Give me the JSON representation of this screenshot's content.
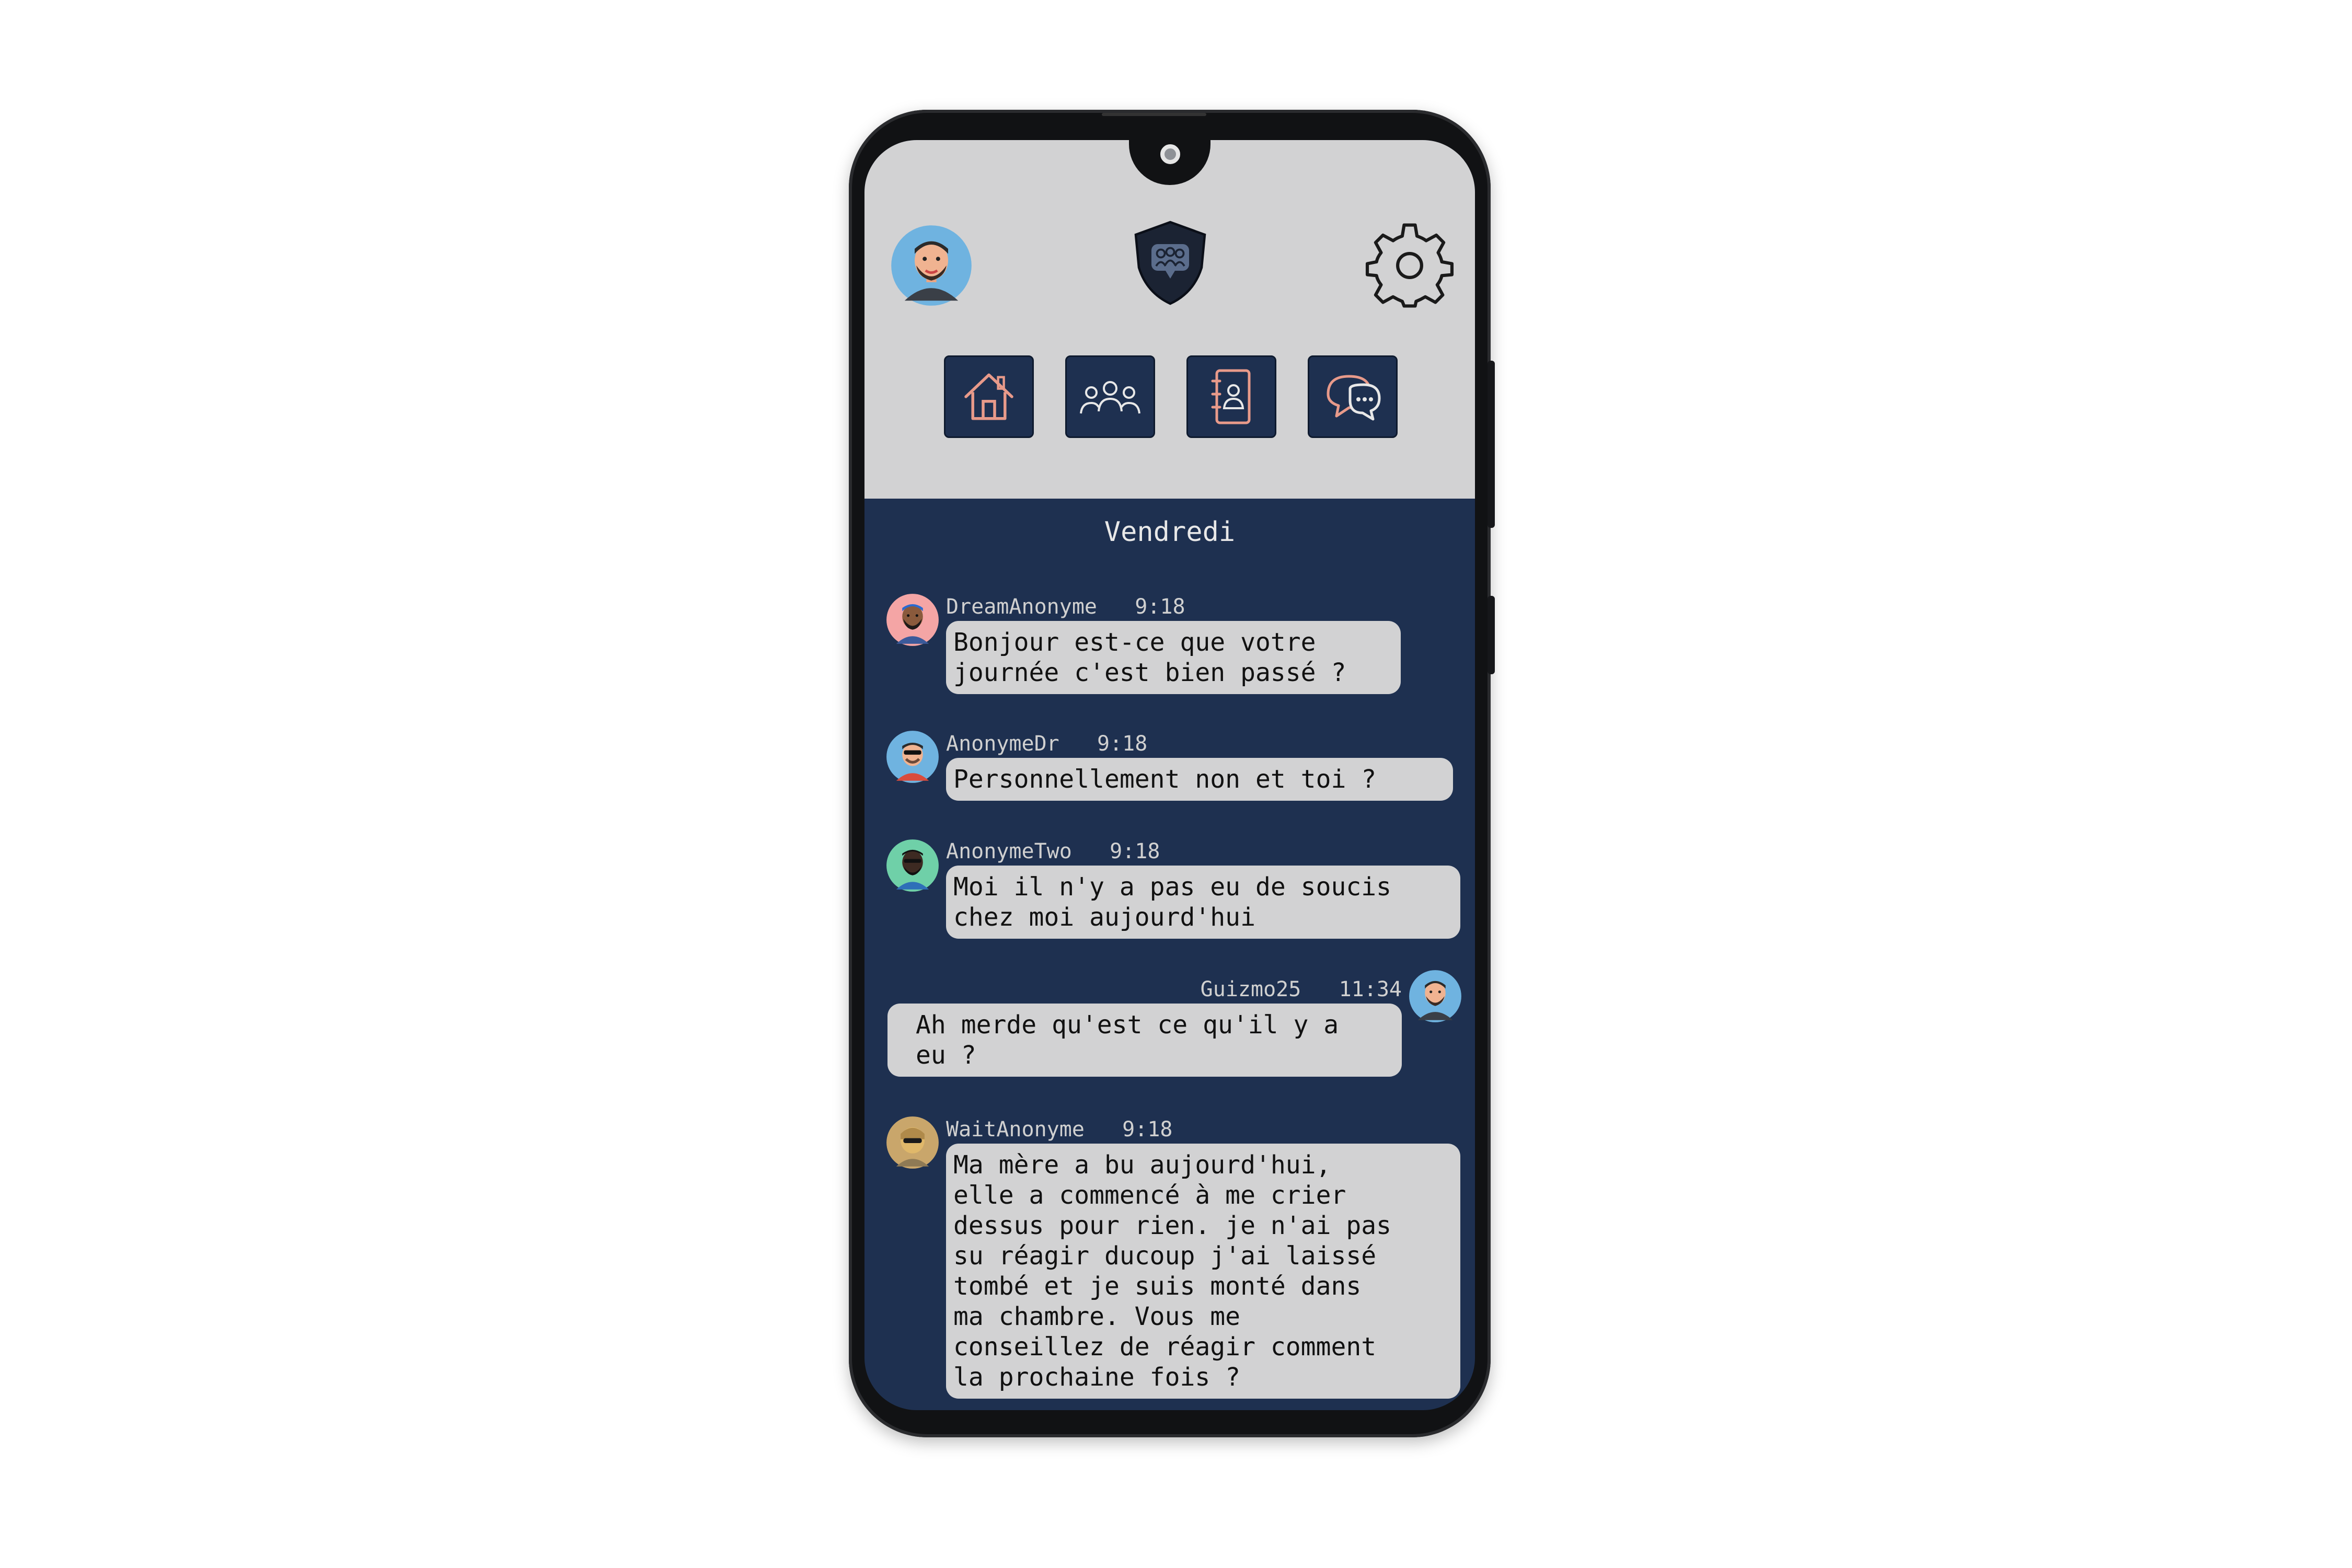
{
  "day_label": "Vendredi",
  "icons": {
    "profile": "avatar",
    "logo": "shield-chat-logo",
    "settings": "gear-icon",
    "nav": [
      "home-icon",
      "group-icon",
      "contacts-icon",
      "chat-icon"
    ]
  },
  "colors": {
    "screen_bg": "#1e3050",
    "header_bg": "#d2d2d3",
    "bubble_bg": "#d2d2d3",
    "icon_accent": "#e89a8a"
  },
  "messages": [
    {
      "user": "DreamAnonyme",
      "time": "9:18",
      "text": "Bonjour est-ce que votre\njournée c'est bien passé ?",
      "side": "left"
    },
    {
      "user": "AnonymeDr",
      "time": "9:18",
      "text": "Personnellement non et toi ?",
      "side": "left"
    },
    {
      "user": "AnonymeTwo",
      "time": "9:18",
      "text": "Moi il n'y a pas eu de soucis\nchez moi aujourd'hui",
      "side": "left"
    },
    {
      "user": "Guizmo25",
      "time": "11:34",
      "text": "Ah merde qu'est ce qu'il y a\neu ?",
      "side": "right"
    },
    {
      "user": "WaitAnonyme",
      "time": "9:18",
      "text": "Ma mère a bu aujourd'hui,\nelle a commencé à me crier\ndessus pour rien. je n'ai pas\nsu réagir ducoup j'ai laissé\ntombé et je suis monté dans\nma chambre. Vous me\nconseillez de réagir comment\nla prochaine fois ?",
      "side": "left"
    }
  ]
}
